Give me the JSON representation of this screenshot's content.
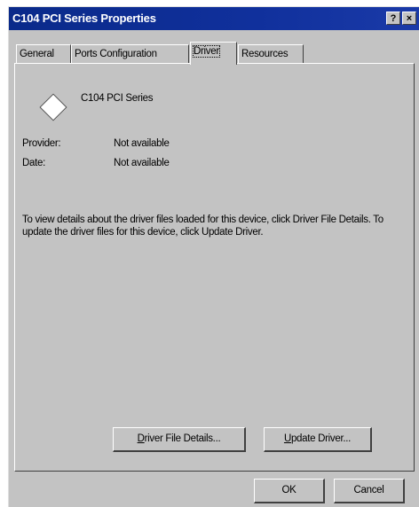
{
  "window": {
    "title": "C104 PCI Series Properties",
    "help_button": "?",
    "close_button": "×"
  },
  "tabs": [
    {
      "label": "General"
    },
    {
      "label": "Ports Configuration"
    },
    {
      "label": "Driver",
      "active": true
    },
    {
      "label": "Resources"
    }
  ],
  "device": {
    "name": "C104 PCI Series"
  },
  "info": {
    "provider_label": "Provider:",
    "provider_value": "Not available",
    "date_label": "Date:",
    "date_value": "Not available"
  },
  "description": "To view details about the driver files loaded for this device, click Driver File Details.  To update the driver files for this device, click Update Driver.",
  "buttons": {
    "driver_file_details": {
      "mnemonic": "D",
      "rest": "river File Details..."
    },
    "update_driver": {
      "mnemonic": "U",
      "rest": "pdate Driver..."
    },
    "ok": "OK",
    "cancel": "Cancel"
  }
}
